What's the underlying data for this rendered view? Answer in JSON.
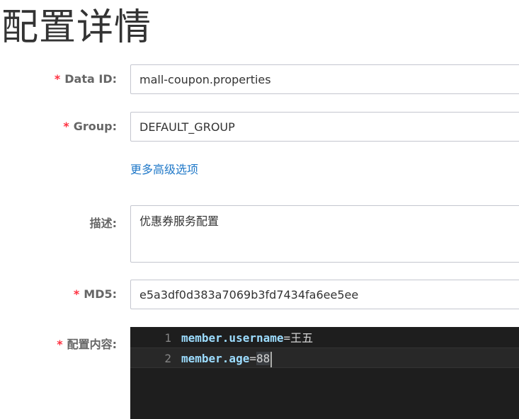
{
  "page": {
    "title": "配置详情"
  },
  "form": {
    "data_id": {
      "required_mark": "*",
      "label": "Data ID:",
      "value": "mall-coupon.properties"
    },
    "group": {
      "required_mark": "*",
      "label": "Group:",
      "value": "DEFAULT_GROUP"
    },
    "advanced_link": "更多高级选项",
    "description": {
      "label": "描述:",
      "value": "优惠券服务配置"
    },
    "md5": {
      "required_mark": "*",
      "label": "MD5:",
      "value": "e5a3df0d383a7069b3fd7434fa6ee5ee"
    },
    "content": {
      "required_mark": "*",
      "label": "配置内容:",
      "lines": [
        {
          "number": "1",
          "key": "member.username",
          "eq": "=",
          "value": "王五"
        },
        {
          "number": "2",
          "key": "member.age",
          "eq": "=",
          "value": "88"
        }
      ]
    }
  },
  "colors": {
    "required": "#ff3040",
    "link": "#1f78c8",
    "editor_bg": "#1e1e1e",
    "code_key": "#9cdcfe"
  }
}
